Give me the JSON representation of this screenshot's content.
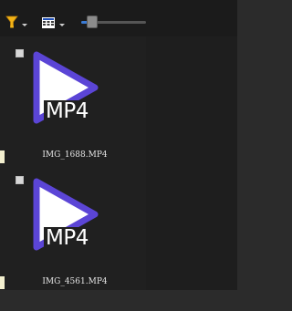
{
  "toolbar": {
    "filter_icon": "filter-funnel-icon",
    "view_icon": "grid-view-icon",
    "accent_color": "#3a7bd5"
  },
  "files": [
    {
      "name": "IMG_1688.MP4",
      "ext_label": "MP4",
      "icon": "video-play-icon"
    },
    {
      "name": "IMG_4561.MP4",
      "ext_label": "MP4",
      "icon": "video-play-icon"
    }
  ],
  "colors": {
    "play_icon_purple": "#5b45d6",
    "panel_background": "#202020"
  }
}
